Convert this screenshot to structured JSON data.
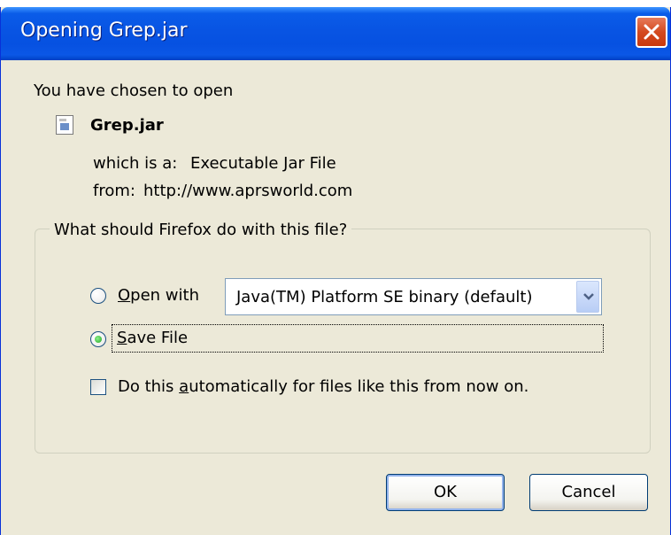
{
  "window": {
    "title": "Opening Grep.jar"
  },
  "intro": {
    "text": "You have chosen to open"
  },
  "file": {
    "name": "Grep.jar",
    "type_label": "which is a:",
    "type_value": "Executable Jar File",
    "from_label": "from:",
    "from_value": "http://www.aprsworld.com"
  },
  "group": {
    "legend": "What should Firefox do with this file?"
  },
  "options": {
    "open_with_label": "Open with",
    "open_with_app": "Java(TM) Platform SE binary (default)",
    "save_file_label": "Save File",
    "selected": "save_file",
    "auto_label": "Do this automatically for files like this from now on.",
    "auto_checked": false
  },
  "buttons": {
    "ok": "OK",
    "cancel": "Cancel"
  },
  "colors": {
    "titlebar": "#0854e3",
    "dialog_bg": "#ece9d8",
    "close_button": "#d44a20"
  },
  "icons": {
    "file": "jar-file-icon",
    "close": "close-icon",
    "dropdown": "chevron-down-icon"
  }
}
